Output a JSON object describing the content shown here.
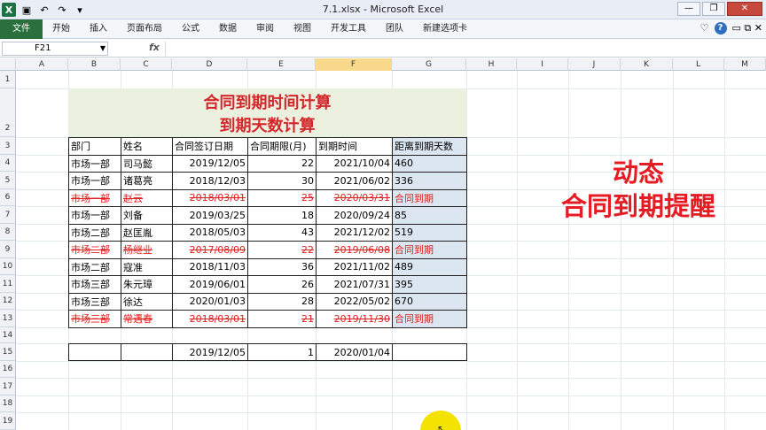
{
  "window": {
    "title": "7.1.xlsx  -  Microsoft Excel"
  },
  "quick_access": [
    {
      "name": "excel-logo-icon",
      "glyph": "X"
    },
    {
      "name": "save-icon",
      "glyph": "▣"
    },
    {
      "name": "undo-icon",
      "glyph": "↶"
    },
    {
      "name": "redo-icon",
      "glyph": "↷"
    },
    {
      "name": "customize-icon",
      "glyph": "▾"
    }
  ],
  "window_buttons": {
    "minimize": "—",
    "restore": "❐",
    "close": "✕"
  },
  "ribbon": {
    "file_tab": "文件",
    "tabs": [
      "开始",
      "插入",
      "页面布局",
      "公式",
      "数据",
      "审阅",
      "视图",
      "开发工具",
      "团队",
      "新建选项卡"
    ],
    "right": {
      "minimize_ribbon": "♡",
      "help": "?",
      "more": "▭ ⧉ ✕"
    }
  },
  "formula_bar": {
    "name_box": "F21",
    "fx": "fx",
    "value": ""
  },
  "columns": [
    "A",
    "B",
    "C",
    "D",
    "E",
    "F",
    "G",
    "H",
    "I",
    "J",
    "K",
    "L",
    "M"
  ],
  "rows": [
    "1",
    "2",
    "3",
    "4",
    "5",
    "6",
    "7",
    "8",
    "9",
    "10",
    "11",
    "12",
    "13",
    "14",
    "15",
    "16",
    "17",
    "18",
    "19"
  ],
  "sheet": {
    "title_line1": "合同到期时间计算",
    "title_line2": "到期天数计算",
    "headers": [
      "部门",
      "姓名",
      "合同签订日期",
      "合同期限(月)",
      "到期时间",
      "距离到期天数"
    ],
    "records": [
      {
        "dept": "市场一部",
        "name": "司马懿",
        "sign": "2019/12/05",
        "months": "22",
        "due": "2021/10/04",
        "days": "460",
        "expired": false
      },
      {
        "dept": "市场一部",
        "name": "诸葛亮",
        "sign": "2018/12/03",
        "months": "30",
        "due": "2021/06/02",
        "days": "336",
        "expired": false
      },
      {
        "dept": "市场一部",
        "name": "赵云",
        "sign": "2018/03/01",
        "months": "25",
        "due": "2020/03/31",
        "days": "合同到期",
        "expired": true
      },
      {
        "dept": "市场一部",
        "name": "刘备",
        "sign": "2019/03/25",
        "months": "18",
        "due": "2020/09/24",
        "days": "85",
        "expired": false
      },
      {
        "dept": "市场二部",
        "name": "赵匡胤",
        "sign": "2018/05/03",
        "months": "43",
        "due": "2021/12/02",
        "days": "519",
        "expired": false
      },
      {
        "dept": "市场二部",
        "name": "杨继业",
        "sign": "2017/08/09",
        "months": "22",
        "due": "2019/06/08",
        "days": "合同到期",
        "expired": true
      },
      {
        "dept": "市场二部",
        "name": "寇准",
        "sign": "2018/11/03",
        "months": "36",
        "due": "2021/11/02",
        "days": "489",
        "expired": false
      },
      {
        "dept": "市场三部",
        "name": "朱元璋",
        "sign": "2019/06/01",
        "months": "26",
        "due": "2021/07/31",
        "days": "395",
        "expired": false
      },
      {
        "dept": "市场三部",
        "name": "徐达",
        "sign": "2020/01/03",
        "months": "28",
        "due": "2022/05/02",
        "days": "670",
        "expired": false
      },
      {
        "dept": "市场三部",
        "name": "常遇春",
        "sign": "2018/03/01",
        "months": "21",
        "due": "2019/11/30",
        "days": "合同到期",
        "expired": true
      }
    ],
    "row15": {
      "sign": "2019/12/05",
      "months": "1",
      "due": "2020/01/04"
    }
  },
  "annotation": {
    "line1": "动态",
    "line2": "合同到期提醒"
  },
  "colors": {
    "accent_red": "#e51c23",
    "title_bg": "#ebf1de",
    "days_bg": "#dce6f1",
    "file_tab": "#2a6f3d"
  }
}
